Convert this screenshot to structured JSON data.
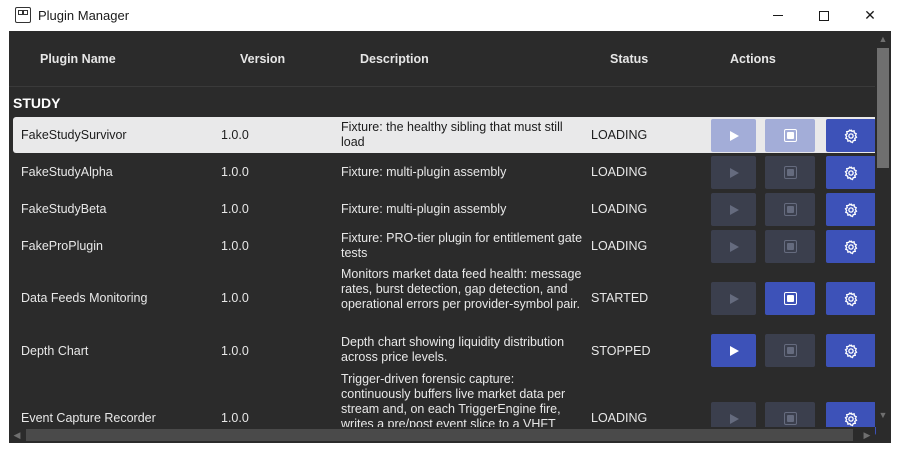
{
  "window": {
    "title": "Plugin Manager"
  },
  "table": {
    "headers": {
      "name": "Plugin Name",
      "version": "Version",
      "description": "Description",
      "status": "Status",
      "actions": "Actions"
    },
    "group": "STUDY",
    "rows": [
      {
        "name": "FakeStudySurvivor",
        "version": "1.0.0",
        "description": "Fixture: the healthy sibling that must still load",
        "status": "LOADING",
        "play_enabled": false,
        "stop_enabled": false,
        "selected": true
      },
      {
        "name": "FakeStudyAlpha",
        "version": "1.0.0",
        "description": "Fixture: multi-plugin assembly",
        "status": "LOADING",
        "play_enabled": false,
        "stop_enabled": false
      },
      {
        "name": "FakeStudyBeta",
        "version": "1.0.0",
        "description": "Fixture: multi-plugin assembly",
        "status": "LOADING",
        "play_enabled": false,
        "stop_enabled": false
      },
      {
        "name": "FakeProPlugin",
        "version": "1.0.0",
        "description": "Fixture: PRO-tier plugin for entitlement gate tests",
        "status": "LOADING",
        "play_enabled": false,
        "stop_enabled": false
      },
      {
        "name": "Data Feeds Monitoring",
        "version": "1.0.0",
        "description": "Monitors market data feed health: message rates, burst detection, gap detection, and operational errors per provider-symbol pair.",
        "status": "STARTED",
        "play_enabled": false,
        "stop_enabled": true
      },
      {
        "name": "Depth Chart",
        "version": "1.0.0",
        "description": "Depth chart showing liquidity distribution across price levels.",
        "status": "STOPPED",
        "play_enabled": true,
        "stop_enabled": false
      },
      {
        "name": "Event Capture Recorder",
        "version": "1.0.0",
        "description": "Trigger-driven forensic capture: continuously buffers live market data per stream and, on each TriggerEngine fire, writes a pre/post event slice to a VHFT",
        "status": "LOADING",
        "play_enabled": false,
        "stop_enabled": false
      }
    ]
  },
  "icons": {
    "play": "play-icon",
    "stop": "stop-icon",
    "settings": "gear-icon"
  },
  "colors": {
    "background": "#2b2b2b",
    "accent": "#3d52b8",
    "selected_row": "#e9e9ea",
    "disabled_button": "#3b3f4d"
  }
}
